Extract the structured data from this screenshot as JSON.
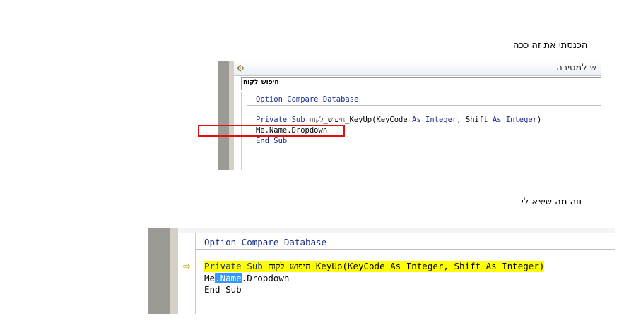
{
  "captions": {
    "first": "הכנסתי את זה ככה",
    "second": "וזה מה שיצא לי"
  },
  "shot1": {
    "window_title": "ש למסירה",
    "procedure_combo": "חיפוש_לקוח",
    "code": {
      "option_kw": "Option Compare Database",
      "line2_kw1": "Private Sub ",
      "line2_heb": "חיפוש_לקוח",
      "line2_rest1": "_KeyUp(KeyCode ",
      "line2_as1": "As Integer",
      "line2_mid": ", Shift ",
      "line2_as2": "As Integer",
      "line2_end": ")",
      "line3": "Me.Name.Dropdown",
      "line4": "End Sub"
    }
  },
  "shot2": {
    "code": {
      "option_kw": "Option Compare Database",
      "line2_kw1": "Private Sub ",
      "line2_heb": "חיפוש_לקוח",
      "line2_rest": "_KeyUp(KeyCode As Integer, Shift As Integer)",
      "line3_a": "Me",
      "line3_sel": ".Name",
      "line3_b": ".Dropdown",
      "line4": "End Sub"
    },
    "exec_arrow_icon": "execution-pointer-arrow-icon",
    "highlight_color": "#ffff00",
    "selection_color": "#3399ff"
  },
  "annotation": {
    "box_color": "#e01010"
  }
}
